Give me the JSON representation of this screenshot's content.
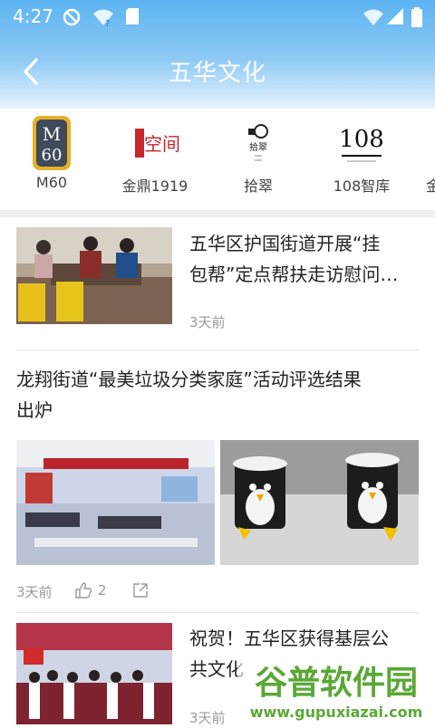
{
  "status_bar": {
    "time": "4:27"
  },
  "header": {
    "title": "五华文化"
  },
  "tabs": [
    {
      "label": "M60",
      "logo_text": "M60"
    },
    {
      "label": "金鼎1919",
      "logo_text": "空间"
    },
    {
      "label": "拾翠",
      "logo_text": "拾翠"
    },
    {
      "label": "108智库",
      "logo_text": "108"
    },
    {
      "label": "金"
    }
  ],
  "feed": {
    "items": [
      {
        "headline_line1": "五华区护国街道开展“挂",
        "headline_line2": "包帮”定点帮扶走访慰问…",
        "time": "3天前"
      },
      {
        "headline_line1": "龙翔街道“最美垃圾分类家庭”活动评选结果",
        "headline_line2": "出炉",
        "time": "3天前",
        "likes": "2"
      },
      {
        "headline_line1": "祝贺！五华区获得基层公",
        "headline_line2": "共文化",
        "time": "3天前"
      }
    ]
  },
  "watermark": {
    "text_cn": "谷普软件园",
    "text_en": "www.gupuxiazai.com"
  },
  "colors": {
    "header_top": "#5cb4f1",
    "accent_red": "#c8262c",
    "divider": "#e6e6e6"
  }
}
